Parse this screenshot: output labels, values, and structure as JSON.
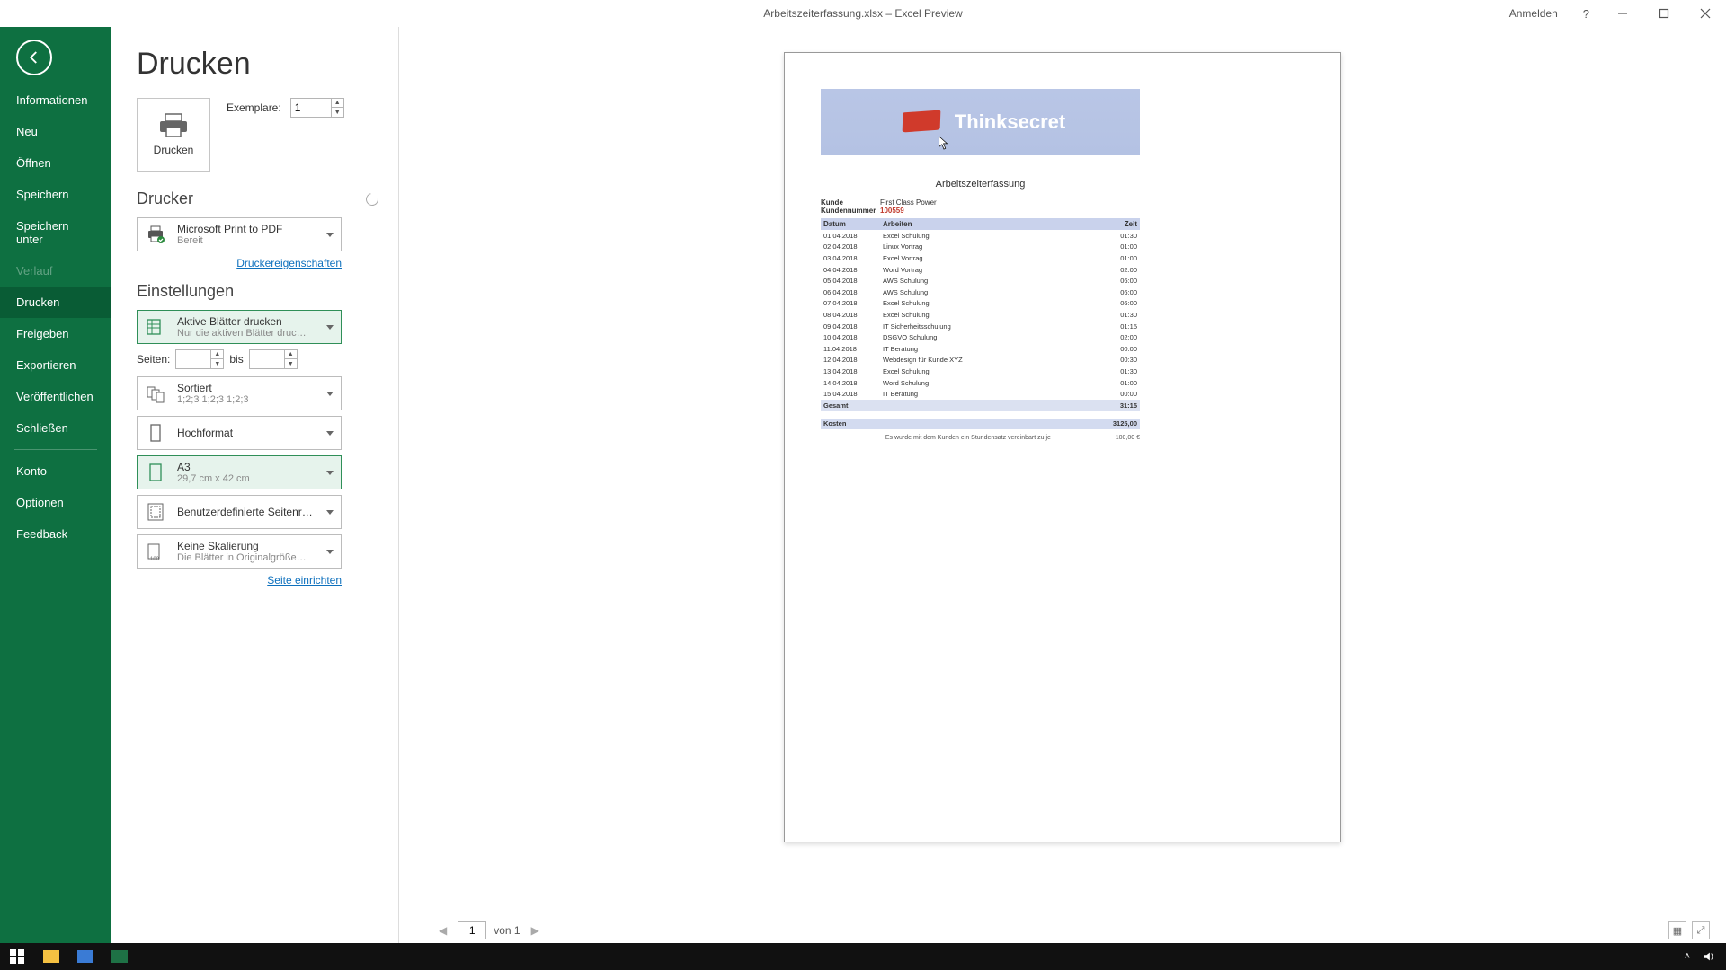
{
  "title": "Arbeitszeiterfassung.xlsx – Excel Preview",
  "titlebar": {
    "signin": "Anmelden",
    "help": "?"
  },
  "sidebar": {
    "items": [
      "Informationen",
      "Neu",
      "Öffnen",
      "Speichern",
      "Speichern unter",
      "Verlauf",
      "Drucken",
      "Freigeben",
      "Exportieren",
      "Veröffentlichen",
      "Schließen"
    ],
    "footer": [
      "Konto",
      "Optionen",
      "Feedback"
    ],
    "active_index": 6,
    "disabled_index": 5
  },
  "page": {
    "title": "Drucken",
    "print_btn": "Drucken",
    "copies_label": "Exemplare:",
    "copies_value": "1",
    "printer_header": "Drucker",
    "printer_name": "Microsoft Print to PDF",
    "printer_status": "Bereit",
    "printer_props": "Druckereigenschaften",
    "settings_header": "Einstellungen",
    "scope_line1": "Aktive Blätter drucken",
    "scope_line2": "Nur die aktiven Blätter druc…",
    "pages_label": "Seiten:",
    "pages_to": "bis",
    "collate_line1": "Sortiert",
    "collate_line2": "1;2;3    1;2;3    1;2;3",
    "orient": "Hochformat",
    "paper_line1": "A3",
    "paper_line2": "29,7 cm x 42 cm",
    "margins": "Benutzerdefinierte Seitenrän…",
    "scaling_line1": "Keine Skalierung",
    "scaling_line2": "Die Blätter in Originalgröße…",
    "page_setup": "Seite einrichten"
  },
  "nav": {
    "page": "1",
    "of": "von 1"
  },
  "doc": {
    "brand": "Thinksecret",
    "title": "Arbeitszeiterfassung",
    "kunde_k": "Kunde",
    "kunde_v": "First Class Power",
    "knr_k": "Kundennummer",
    "knr_v": "100559",
    "th_date": "Datum",
    "th_work": "Arbeiten",
    "th_time": "Zeit",
    "rows": [
      {
        "d": "01.04.2018",
        "w": "Excel Schulung",
        "t": "01:30"
      },
      {
        "d": "02.04.2018",
        "w": "Linux Vortrag",
        "t": "01:00"
      },
      {
        "d": "03.04.2018",
        "w": "Excel Vortrag",
        "t": "01:00"
      },
      {
        "d": "04.04.2018",
        "w": "Word Vortrag",
        "t": "02:00"
      },
      {
        "d": "05.04.2018",
        "w": "AWS Schulung",
        "t": "06:00"
      },
      {
        "d": "06.04.2018",
        "w": "AWS Schulung",
        "t": "06:00"
      },
      {
        "d": "07.04.2018",
        "w": "Excel Schulung",
        "t": "06:00"
      },
      {
        "d": "08.04.2018",
        "w": "Excel Schulung",
        "t": "01:30"
      },
      {
        "d": "09.04.2018",
        "w": "IT Sicherheitsschulung",
        "t": "01:15"
      },
      {
        "d": "10.04.2018",
        "w": "DSGVO Schulung",
        "t": "02:00"
      },
      {
        "d": "11.04.2018",
        "w": "IT Beratung",
        "t": "00:00"
      },
      {
        "d": "12.04.2018",
        "w": "Webdesign für Kunde XYZ",
        "t": "00:30"
      },
      {
        "d": "13.04.2018",
        "w": "Excel Schulung",
        "t": "01:30"
      },
      {
        "d": "14.04.2018",
        "w": "Word Schulung",
        "t": "01:00"
      },
      {
        "d": "15.04.2018",
        "w": "IT Beratung",
        "t": "00:00"
      }
    ],
    "total_k": "Gesamt",
    "total_v": "31:15",
    "cost_k": "Kosten",
    "cost_v": "3125,00",
    "note": "Es wurde mit dem Kunden ein Stundensatz vereinbart zu je",
    "rate": "100,00 €"
  }
}
